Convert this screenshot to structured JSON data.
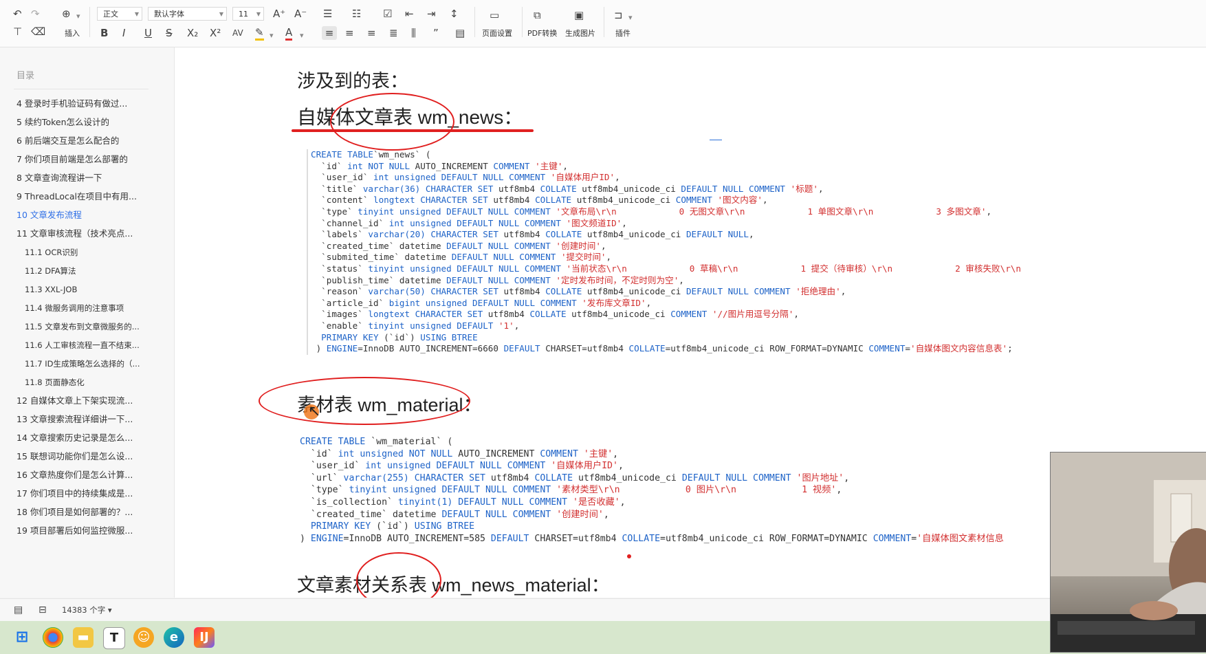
{
  "toolbar": {
    "style_select": "正文",
    "font_select": "默认字体",
    "size_select": "11",
    "insert_label": "插入",
    "page_setup_label": "页面设置",
    "pdf_label": "PDF转换",
    "image_label": "生成图片",
    "plugin_label": "插件"
  },
  "sidebar": {
    "title": "目录",
    "items": [
      {
        "label": "4  登录时手机验证码有做过...",
        "level": 1
      },
      {
        "label": "5  续约Token怎么设计的",
        "level": 1
      },
      {
        "label": "6  前后端交互是怎么配合的",
        "level": 1
      },
      {
        "label": "7  你们项目前端是怎么部署的",
        "level": 1
      },
      {
        "label": "8  文章查询流程讲一下",
        "level": 1
      },
      {
        "label": "9  ThreadLocal在项目中有用...",
        "level": 1
      },
      {
        "label": "10  文章发布流程",
        "level": 1,
        "active": true
      },
      {
        "label": "11  文章审核流程（技术亮点...",
        "level": 1
      },
      {
        "label": "11.1  OCR识别",
        "level": 2
      },
      {
        "label": "11.2  DFA算法",
        "level": 2
      },
      {
        "label": "11.3  XXL-JOB",
        "level": 2
      },
      {
        "label": "11.4  微服务调用的注意事项",
        "level": 2
      },
      {
        "label": "11.5  文章发布到文章微服务的...",
        "level": 2
      },
      {
        "label": "11.6  人工审核流程一直不结束...",
        "level": 2
      },
      {
        "label": "11.7  ID生成策略怎么选择的（...",
        "level": 2
      },
      {
        "label": "11.8  页面静态化",
        "level": 2
      },
      {
        "label": "12  自媒体文章上下架实现流...",
        "level": 1
      },
      {
        "label": "13  文章搜索流程详细讲一下...",
        "level": 1
      },
      {
        "label": "14  文章搜索历史记录是怎么...",
        "level": 1
      },
      {
        "label": "15  联想词功能你们是怎么设...",
        "level": 1
      },
      {
        "label": "16  文章热度你们是怎么计算...",
        "level": 1
      },
      {
        "label": "17  你们项目中的持续集成是...",
        "level": 1
      },
      {
        "label": "18  你们项目是如何部署的？...",
        "level": 1
      },
      {
        "label": "19  项目部署后如何监控微服...",
        "level": 1
      }
    ]
  },
  "document": {
    "h_tables": "涉及到的表：",
    "h_wm_news": "自媒体文章表 wm_news：",
    "code_wm_news": [
      [
        [
          "kw",
          "CREATE TABLE"
        ],
        [
          "",
          "`wm_news` ("
        ]
      ],
      [
        [
          "",
          "  `id` "
        ],
        [
          "kw",
          "int NOT NULL"
        ],
        [
          "",
          " AUTO_INCREMENT "
        ],
        [
          "kw",
          "COMMENT"
        ],
        [
          "str",
          " '主键'"
        ],
        [
          "",
          ","
        ]
      ],
      [
        [
          "",
          "  `user_id` "
        ],
        [
          "kw",
          "int unsigned DEFAULT NULL COMMENT"
        ],
        [
          "str",
          " '自媒体用户ID'"
        ],
        [
          "",
          ","
        ]
      ],
      [
        [
          "",
          "  `title` "
        ],
        [
          "kw",
          "varchar(36) CHARACTER SET"
        ],
        [
          "",
          " utf8mb4 "
        ],
        [
          "kw",
          "COLLATE"
        ],
        [
          "",
          " utf8mb4_unicode_ci "
        ],
        [
          "kw",
          "DEFAULT NULL COMMENT"
        ],
        [
          "str",
          " '标题'"
        ],
        [
          "",
          ","
        ]
      ],
      [
        [
          "",
          "  `content` "
        ],
        [
          "kw",
          "longtext CHARACTER SET"
        ],
        [
          "",
          " utf8mb4 "
        ],
        [
          "kw",
          "COLLATE"
        ],
        [
          "",
          " utf8mb4_unicode_ci "
        ],
        [
          "kw",
          "COMMENT"
        ],
        [
          "str",
          " '图文内容'"
        ],
        [
          "",
          ","
        ]
      ],
      [
        [
          "",
          "  `type` "
        ],
        [
          "kw",
          "tinyint unsigned DEFAULT NULL COMMENT"
        ],
        [
          "str",
          " '文章布局\\r\\n            0 无图文章\\r\\n            1 单图文章\\r\\n            3 多图文章'"
        ],
        [
          "",
          ","
        ]
      ],
      [
        [
          "",
          "  `channel_id` "
        ],
        [
          "kw",
          "int unsigned DEFAULT NULL COMMENT"
        ],
        [
          "str",
          " '图文频道ID'"
        ],
        [
          "",
          ","
        ]
      ],
      [
        [
          "",
          "  `labels` "
        ],
        [
          "kw",
          "varchar(20) CHARACTER SET"
        ],
        [
          "",
          " utf8mb4 "
        ],
        [
          "kw",
          "COLLATE"
        ],
        [
          "",
          " utf8mb4_unicode_ci "
        ],
        [
          "kw",
          "DEFAULT NULL"
        ],
        [
          "",
          ","
        ]
      ],
      [
        [
          "",
          "  `created_time` "
        ],
        [
          "",
          "datetime "
        ],
        [
          "kw",
          "DEFAULT NULL COMMENT"
        ],
        [
          "str",
          " '创建时间'"
        ],
        [
          "",
          ","
        ]
      ],
      [
        [
          "",
          "  `submited_time` "
        ],
        [
          "",
          "datetime "
        ],
        [
          "kw",
          "DEFAULT NULL COMMENT"
        ],
        [
          "str",
          " '提交时间'"
        ],
        [
          "",
          ","
        ]
      ],
      [
        [
          "",
          "  `status` "
        ],
        [
          "kw",
          "tinyint unsigned DEFAULT NULL COMMENT"
        ],
        [
          "str",
          " '当前状态\\r\\n            0 草稿\\r\\n            1 提交（待审核）\\r\\n            2 审核失败\\r\\n"
        ]
      ],
      [
        [
          "",
          "  `publish_time` "
        ],
        [
          "",
          "datetime "
        ],
        [
          "kw",
          "DEFAULT NULL COMMENT"
        ],
        [
          "str",
          " '定时发布时间，不定时则为空'"
        ],
        [
          "",
          ","
        ]
      ],
      [
        [
          "",
          "  `reason` "
        ],
        [
          "kw",
          "varchar(50) CHARACTER SET"
        ],
        [
          "",
          " utf8mb4 "
        ],
        [
          "kw",
          "COLLATE"
        ],
        [
          "",
          " utf8mb4_unicode_ci "
        ],
        [
          "kw",
          "DEFAULT NULL COMMENT"
        ],
        [
          "str",
          " '拒绝理由'"
        ],
        [
          "",
          ","
        ]
      ],
      [
        [
          "",
          "  `article_id` "
        ],
        [
          "kw",
          "bigint unsigned DEFAULT NULL COMMENT"
        ],
        [
          "str",
          " '发布库文章ID'"
        ],
        [
          "",
          ","
        ]
      ],
      [
        [
          "",
          "  `images` "
        ],
        [
          "kw",
          "longtext CHARACTER SET"
        ],
        [
          "",
          " utf8mb4 "
        ],
        [
          "kw",
          "COLLATE"
        ],
        [
          "",
          " utf8mb4_unicode_ci "
        ],
        [
          "kw",
          "COMMENT"
        ],
        [
          "str",
          " '//图片用逗号分隔'"
        ],
        [
          "",
          ","
        ]
      ],
      [
        [
          "",
          "  `enable` "
        ],
        [
          "kw",
          "tinyint unsigned DEFAULT"
        ],
        [
          "str",
          " '1'"
        ],
        [
          "",
          ","
        ]
      ],
      [
        [
          "kw",
          "  PRIMARY KEY"
        ],
        [
          "",
          " (`id`) "
        ],
        [
          "kw",
          "USING BTREE"
        ]
      ],
      [
        [
          "",
          " ) "
        ],
        [
          "kw",
          "ENGINE"
        ],
        [
          "",
          "=InnoDB AUTO_INCREMENT=6660 "
        ],
        [
          "kw",
          "DEFAULT"
        ],
        [
          "",
          " CHARSET=utf8mb4 "
        ],
        [
          "kw",
          "COLLATE"
        ],
        [
          "",
          "=utf8mb4_unicode_ci ROW_FORMAT=DYNAMIC "
        ],
        [
          "kw",
          "COMMENT"
        ],
        [
          "",
          "="
        ],
        [
          "str",
          "'自媒体图文内容信息表'"
        ],
        [
          "",
          ";"
        ]
      ]
    ],
    "h_wm_material": "素材表 wm_material：",
    "code_wm_material": [
      [
        [
          "kw",
          "CREATE TABLE"
        ],
        [
          "",
          " `wm_material` ("
        ]
      ],
      [
        [
          "",
          "  `id` "
        ],
        [
          "kw",
          "int unsigned NOT NULL"
        ],
        [
          "",
          " AUTO_INCREMENT "
        ],
        [
          "kw",
          "COMMENT"
        ],
        [
          "str",
          " '主键'"
        ],
        [
          "",
          ","
        ]
      ],
      [
        [
          "",
          "  `user_id` "
        ],
        [
          "kw",
          "int unsigned DEFAULT NULL COMMENT"
        ],
        [
          "str",
          " '自媒体用户ID'"
        ],
        [
          "",
          ","
        ]
      ],
      [
        [
          "",
          "  `url` "
        ],
        [
          "kw",
          "varchar(255) CHARACTER SET"
        ],
        [
          "",
          " utf8mb4 "
        ],
        [
          "kw",
          "COLLATE"
        ],
        [
          "",
          " utf8mb4_unicode_ci "
        ],
        [
          "kw",
          "DEFAULT NULL COMMENT"
        ],
        [
          "str",
          " '图片地址'"
        ],
        [
          "",
          ","
        ]
      ],
      [
        [
          "",
          "  `type` "
        ],
        [
          "kw",
          "tinyint unsigned DEFAULT NULL COMMENT"
        ],
        [
          "str",
          " '素材类型\\r\\n            0 图片\\r\\n            1 视频'"
        ],
        [
          "",
          ","
        ]
      ],
      [
        [
          "",
          "  `is_collection` "
        ],
        [
          "kw",
          "tinyint(1) DEFAULT NULL COMMENT"
        ],
        [
          "str",
          " '是否收藏'"
        ],
        [
          "",
          ","
        ]
      ],
      [
        [
          "",
          "  `created_time` "
        ],
        [
          "",
          "datetime "
        ],
        [
          "kw",
          "DEFAULT NULL COMMENT"
        ],
        [
          "str",
          " '创建时间'"
        ],
        [
          "",
          ","
        ]
      ],
      [
        [
          "kw",
          "  PRIMARY KEY"
        ],
        [
          "",
          " (`id`) "
        ],
        [
          "kw",
          "USING BTREE"
        ]
      ],
      [
        [
          "",
          ") "
        ],
        [
          "kw",
          "ENGINE"
        ],
        [
          "",
          "=InnoDB AUTO_INCREMENT=585 "
        ],
        [
          "kw",
          "DEFAULT"
        ],
        [
          "",
          " CHARSET=utf8mb4 "
        ],
        [
          "kw",
          "COLLATE"
        ],
        [
          "",
          "=utf8mb4_unicode_ci ROW_FORMAT=DYNAMIC "
        ],
        [
          "kw",
          "COMMENT"
        ],
        [
          "",
          "="
        ],
        [
          "str",
          "'自媒体图文素材信息"
        ]
      ]
    ],
    "h_wm_news_material": "文章素材关系表 wm_news_material："
  },
  "status": {
    "word_count": "14383 个字"
  },
  "colors": {
    "accent": "#2f6fe6",
    "keyword": "#1e63c8",
    "string": "#d23030",
    "annotation": "#e01e1e",
    "taskbar": "#d7e7cd"
  },
  "icons": [
    "undo-icon",
    "redo-icon",
    "insert-icon",
    "format-painter-icon",
    "eraser-icon",
    "bold-icon",
    "italic-icon",
    "underline-icon",
    "strikethrough-icon",
    "subscript-icon",
    "superscript-icon",
    "highlight-icon",
    "font-color-icon",
    "bullet-list-icon",
    "numbered-list-icon",
    "checklist-icon",
    "indent-icon",
    "outdent-icon",
    "line-spacing-icon",
    "align-left-icon",
    "align-center-icon",
    "align-right-icon",
    "justify-icon",
    "distribute-icon",
    "quote-icon",
    "page-setup-icon",
    "pdf-icon",
    "image-icon",
    "plugin-icon",
    "outline-icon",
    "page-view-icon",
    "windows-start-icon",
    "chrome-icon",
    "file-explorer-icon",
    "typora-icon",
    "app-icon",
    "edge-icon",
    "intellij-icon"
  ]
}
